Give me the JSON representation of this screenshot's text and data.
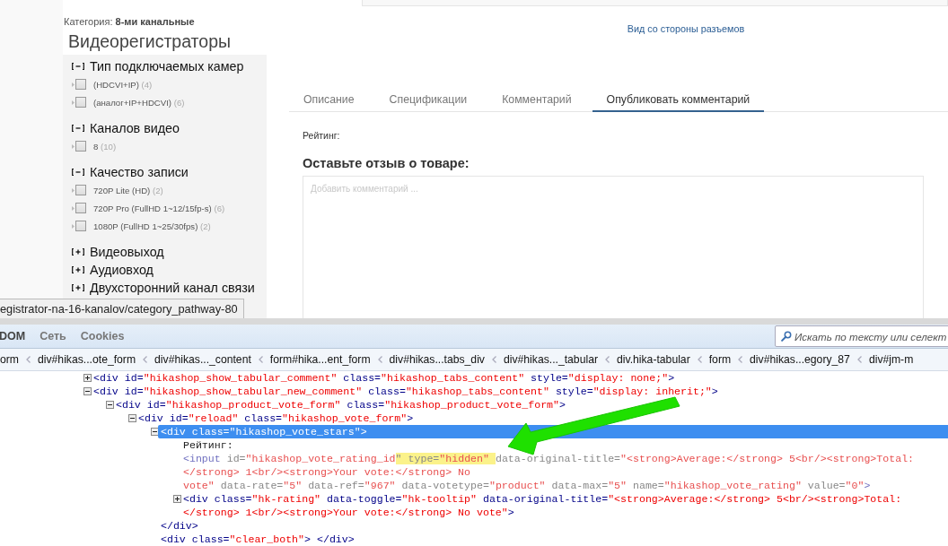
{
  "page": {
    "category_label": "Категория:",
    "category_value": "8-ми канальные",
    "heading": "Видеорегистраторы",
    "filters": [
      {
        "title": "Тип подключаемых камер",
        "expanded": true,
        "items": [
          {
            "label": "(HDCVI+IP)",
            "count": "(4)",
            "checked": false
          },
          {
            "label": "(аналог+IP+HDCVI)",
            "count": "(6)",
            "checked": false
          }
        ]
      },
      {
        "title": "Каналов видео",
        "expanded": true,
        "items": [
          {
            "label": "8",
            "count": "(10)",
            "checked": false
          }
        ]
      },
      {
        "title": "Качество записи",
        "expanded": true,
        "items": [
          {
            "label": "720P Lite (HD)",
            "count": "(2)",
            "checked": false
          },
          {
            "label": "720P Pro (FullHD 1~12/15fp-s)",
            "count": "(6)",
            "checked": false
          },
          {
            "label": "1080P (FullHD 1~25/30fps)",
            "count": "(2)",
            "checked": false
          }
        ]
      },
      {
        "title": "Видеовыход",
        "expanded": false
      },
      {
        "title": "Аудиовход",
        "expanded": false
      },
      {
        "title": "Двухсторонний канал связи",
        "expanded": false
      }
    ],
    "link": "Вид со стороны разъемов",
    "tabs": [
      {
        "label": "Описание",
        "selected": false
      },
      {
        "label": "Спецификации",
        "selected": false
      },
      {
        "label": "Комментарий",
        "selected": false
      },
      {
        "label": "Опубликовать комментарий",
        "selected": true
      }
    ],
    "rating_label": "Рейтинг:",
    "review_heading": "Оставьте отзыв о товаре:",
    "comment": {
      "placeholder": "Добавить комментарий ..."
    },
    "status_url": "egistrator-na-16-kanalov/category_pathway-80"
  },
  "devtools": {
    "tabs": [
      {
        "label": "DOM",
        "selected": true
      },
      {
        "label": "Сеть",
        "selected": false
      },
      {
        "label": "Cookies",
        "selected": false
      }
    ],
    "search": {
      "placeholder": "Искать по тексту или селект"
    },
    "breadcrumbs": [
      "orm",
      "div#hikas...ote_form",
      "div#hikas..._content",
      "form#hika...ent_form",
      "div#hikas...tabs_div",
      "div#hikas..._tabular",
      "div.hika-tabular",
      "form",
      "div#hikas...egory_87",
      "div#jm-m"
    ],
    "dom": [
      {
        "expanded": false,
        "selected": false,
        "lines": [
          [
            {
              "kind": "tag",
              "text": "<div"
            },
            {
              "kind": "attr",
              "text": " id="
            },
            {
              "kind": "val",
              "text": "\"hikashop_show_tabular_comment\""
            },
            {
              "kind": "attr",
              "text": " class="
            },
            {
              "kind": "val",
              "text": "\"hikashop_tabs_content\""
            },
            {
              "kind": "attr",
              "text": " style="
            },
            {
              "kind": "val",
              "text": "\"display: none;\""
            },
            {
              "kind": "tag",
              "text": ">"
            }
          ]
        ]
      },
      {
        "expanded": true,
        "selected": false,
        "lines": [
          [
            {
              "kind": "tag",
              "text": "<div"
            },
            {
              "kind": "attr",
              "text": " id="
            },
            {
              "kind": "val",
              "text": "\"hikashop_show_tabular_new_comment\""
            },
            {
              "kind": "attr",
              "text": " class="
            },
            {
              "kind": "val",
              "text": "\"hikashop_tabs_content\""
            },
            {
              "kind": "attr",
              "text": " style="
            },
            {
              "kind": "val",
              "text": "\"display: inherit;\""
            },
            {
              "kind": "tag",
              "text": ">"
            }
          ]
        ],
        "children": [
          {
            "expanded": true,
            "selected": false,
            "lines": [
              [
                {
                  "kind": "tag",
                  "text": "<div"
                },
                {
                  "kind": "attr",
                  "text": " id="
                },
                {
                  "kind": "val",
                  "text": "\"hikashop_product_vote_form\""
                },
                {
                  "kind": "attr",
                  "text": " class="
                },
                {
                  "kind": "val",
                  "text": "\"hikashop_product_vote_form\""
                },
                {
                  "kind": "tag",
                  "text": ">"
                }
              ]
            ],
            "children": [
              {
                "expanded": true,
                "selected": false,
                "lines": [
                  [
                    {
                      "kind": "tag",
                      "text": "<div"
                    },
                    {
                      "kind": "attr",
                      "text": " id="
                    },
                    {
                      "kind": "val",
                      "text": "\"reload\""
                    },
                    {
                      "kind": "attr",
                      "text": " class="
                    },
                    {
                      "kind": "val",
                      "text": "\"hikashop_vote_form\""
                    },
                    {
                      "kind": "tag",
                      "text": ">"
                    }
                  ]
                ],
                "children": [
                  {
                    "expanded": true,
                    "selected": true,
                    "lines": [
                      [
                        {
                          "kind": "tag",
                          "text": "<div"
                        },
                        {
                          "kind": "attr",
                          "text": " class="
                        },
                        {
                          "kind": "val",
                          "text": "\"hikashop_vote_stars\""
                        },
                        {
                          "kind": "tag",
                          "text": ">"
                        }
                      ]
                    ],
                    "children": [
                      {
                        "selected": false,
                        "lines": [
                          [
                            {
                              "kind": "text",
                              "text": "Рейтинг:"
                            }
                          ]
                        ]
                      },
                      {
                        "selected": false,
                        "dim": true,
                        "lines": [
                          [
                            {
                              "kind": "tag",
                              "text": "<input"
                            },
                            {
                              "kind": "attr",
                              "text": " id="
                            },
                            {
                              "kind": "val",
                              "text": "\"hikashop_vote_rating_id"
                            },
                            {
                              "kind": "attr",
                              "text": "\"",
                              "hl": true
                            },
                            {
                              "kind": "attr",
                              "text": " type=",
                              "hl": true
                            },
                            {
                              "kind": "val",
                              "text": "\"hidden\" ",
                              "hl": true
                            },
                            {
                              "kind": "attr",
                              "text": "data-original-title="
                            },
                            {
                              "kind": "val",
                              "text": "\"<strong>Average:</strong> 5<br/><strong>Total:"
                            }
                          ],
                          [
                            {
                              "kind": "val",
                              "text": "</strong> 1<br/><strong>Your vote:</strong> No"
                            }
                          ],
                          [
                            {
                              "kind": "val",
                              "text": "vote\""
                            },
                            {
                              "kind": "attr",
                              "text": " data-rate="
                            },
                            {
                              "kind": "val",
                              "text": "\"5\""
                            },
                            {
                              "kind": "attr",
                              "text": " data-ref="
                            },
                            {
                              "kind": "val",
                              "text": "\"967\""
                            },
                            {
                              "kind": "attr",
                              "text": " data-votetype="
                            },
                            {
                              "kind": "val",
                              "text": "\"product\""
                            },
                            {
                              "kind": "attr",
                              "text": " data-max="
                            },
                            {
                              "kind": "val",
                              "text": "\"5\""
                            },
                            {
                              "kind": "attr",
                              "text": " name="
                            },
                            {
                              "kind": "val",
                              "text": "\"hikashop_vote_rating\""
                            },
                            {
                              "kind": "attr",
                              "text": " value="
                            },
                            {
                              "kind": "val",
                              "text": "\"0\""
                            },
                            {
                              "kind": "tag",
                              "text": ">"
                            }
                          ]
                        ]
                      },
                      {
                        "expanded": false,
                        "selected": false,
                        "lines": [
                          [
                            {
                              "kind": "tag",
                              "text": "<div"
                            },
                            {
                              "kind": "attr",
                              "text": " class="
                            },
                            {
                              "kind": "val",
                              "text": "\"hk-rating\""
                            },
                            {
                              "kind": "attr",
                              "text": " data-toggle="
                            },
                            {
                              "kind": "val",
                              "text": "\"hk-tooltip\""
                            },
                            {
                              "kind": "attr",
                              "text": " data-original-title="
                            },
                            {
                              "kind": "val",
                              "text": "\"<strong>Average:</strong> 5<br/><strong>Total:"
                            }
                          ],
                          [
                            {
                              "kind": "val",
                              "text": "</strong> 1<br/><strong>Your vote:</strong> No vote\""
                            },
                            {
                              "kind": "tag",
                              "text": ">"
                            }
                          ]
                        ]
                      }
                    ]
                  },
                  {
                    "selected": false,
                    "lines": [
                      [
                        {
                          "kind": "tag",
                          "text": "</div>"
                        }
                      ]
                    ]
                  },
                  {
                    "selected": false,
                    "lines": [
                      [
                        {
                          "kind": "tag",
                          "text": "<div"
                        },
                        {
                          "kind": "attr",
                          "text": " class="
                        },
                        {
                          "kind": "val",
                          "text": "\"clear_both\""
                        },
                        {
                          "kind": "tag",
                          "text": "> </div>"
                        }
                      ]
                    ]
                  }
                ]
              }
            ]
          }
        ]
      }
    ]
  }
}
